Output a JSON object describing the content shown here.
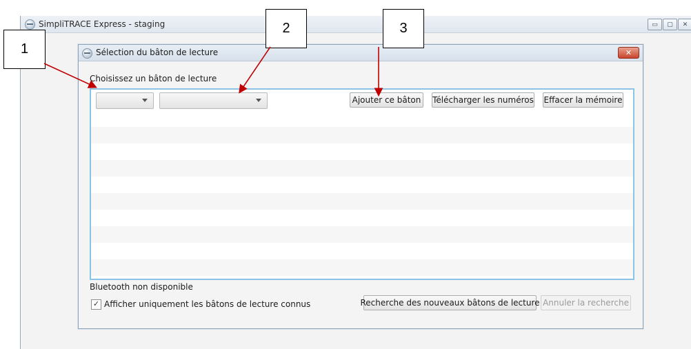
{
  "main_window": {
    "title": "SimpliTRACE Express - staging",
    "controls": {
      "minimize": "▭",
      "maximize": "▢",
      "close": "✕"
    }
  },
  "dialog": {
    "title": "Sélection du bâton de lecture",
    "close_label": "✕",
    "choose_label": "Choisissez un bâton de lecture",
    "combo_1_value": "",
    "combo_2_value": "",
    "buttons": {
      "add": "Ajouter ce bâton",
      "download": "Télécharger les numéros",
      "clear": "Effacer la mémoire",
      "search": "Recherche des nouveaux bâtons de lecture",
      "cancel_search": "Annuler la recherche"
    },
    "bluetooth_status": "Bluetooth non disponible",
    "known_only_checkbox": {
      "label": "Afficher uniquement les bâtons de lecture connus",
      "checked": true,
      "mark": "✓"
    }
  },
  "annotations": [
    {
      "number": "1"
    },
    {
      "number": "2"
    },
    {
      "number": "3"
    }
  ],
  "colors": {
    "arrow": "#c00000",
    "list_border": "#8bc3e6"
  }
}
